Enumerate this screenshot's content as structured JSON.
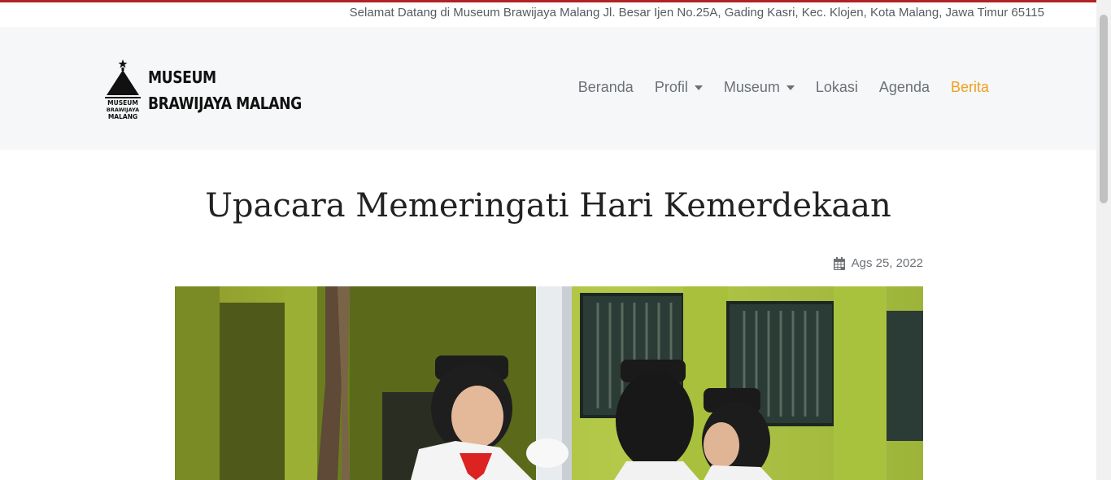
{
  "topbar": {
    "welcome_text": "Selamat Datang di Museum Brawijaya Malang Jl. Besar Ijen No.25A, Gading Kasri, Kec. Klojen, Kota Malang, Jawa Timur 65115"
  },
  "brand": {
    "line1": "MUSEUM",
    "line2": "BRAWIJAYA MALANG",
    "logo_text": "MUSEUM BRAWIJAYA MALANG"
  },
  "nav": {
    "items": [
      {
        "label": "Beranda",
        "dropdown": false
      },
      {
        "label": "Profil",
        "dropdown": true
      },
      {
        "label": "Museum",
        "dropdown": true
      },
      {
        "label": "Lokasi",
        "dropdown": false
      },
      {
        "label": "Agenda",
        "dropdown": false
      },
      {
        "label": "Berita",
        "dropdown": false,
        "active": true
      }
    ],
    "active_color": "#f0a020"
  },
  "article": {
    "title": "Upacara Memeringati Hari Kemerdekaan",
    "date": "Ags 25, 2022",
    "date_icon": "calendar-icon",
    "image_description_icon": "flag-ceremony-photo"
  },
  "colors": {
    "accent_red": "#b22222",
    "nav_bg": "#f6f7f8",
    "text_muted": "#6c7176"
  }
}
